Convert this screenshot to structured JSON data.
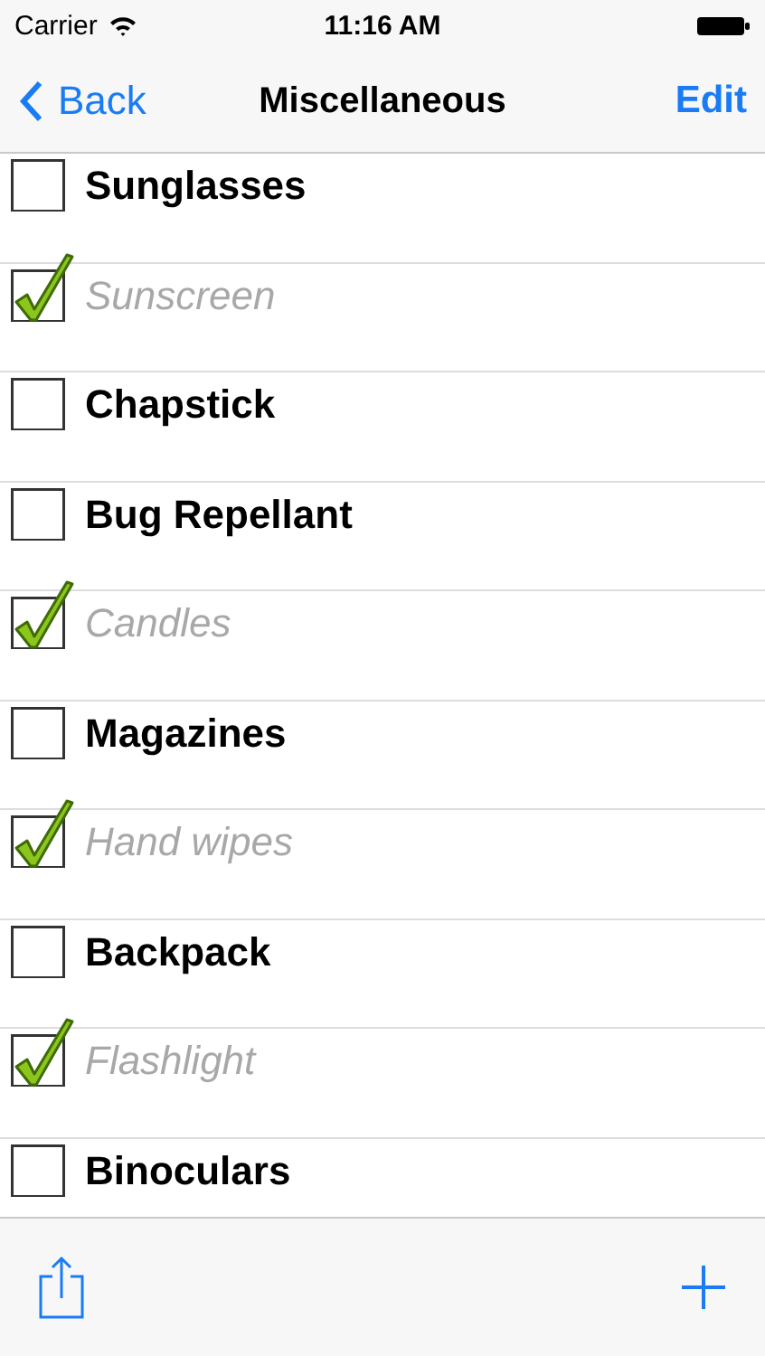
{
  "status_bar": {
    "carrier": "Carrier",
    "time": "11:16 AM"
  },
  "nav": {
    "back": "Back",
    "title": "Miscellaneous",
    "edit": "Edit"
  },
  "items": [
    {
      "label": "Sunglasses",
      "checked": false
    },
    {
      "label": "Sunscreen",
      "checked": true
    },
    {
      "label": "Chapstick",
      "checked": false
    },
    {
      "label": "Bug Repellant",
      "checked": false
    },
    {
      "label": "Candles",
      "checked": true
    },
    {
      "label": "Magazines",
      "checked": false
    },
    {
      "label": "Hand wipes",
      "checked": true
    },
    {
      "label": "Backpack",
      "checked": false
    },
    {
      "label": "Flashlight",
      "checked": true
    },
    {
      "label": "Binoculars",
      "checked": false
    }
  ]
}
